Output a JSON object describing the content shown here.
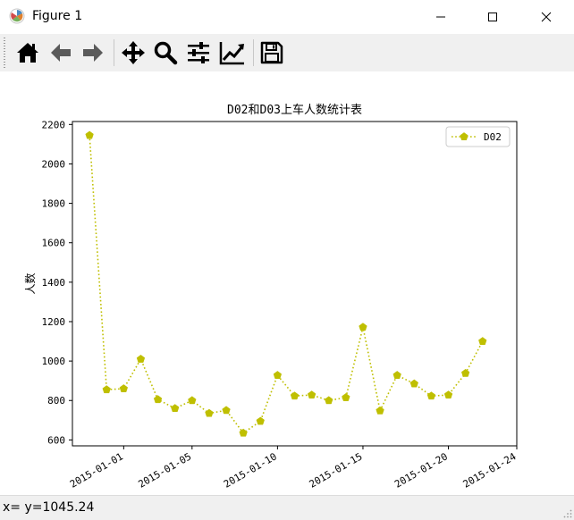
{
  "window": {
    "title": "Figure 1",
    "icon": "matplotlib-icon",
    "controls": [
      "minimize-icon",
      "maximize-icon",
      "close-icon"
    ]
  },
  "toolbar": {
    "buttons": [
      {
        "name": "home",
        "icon": "home-icon"
      },
      {
        "name": "back",
        "icon": "back-arrow-icon"
      },
      {
        "name": "forward",
        "icon": "forward-arrow-icon"
      },
      {
        "name": "pan",
        "icon": "move-icon"
      },
      {
        "name": "zoom",
        "icon": "zoom-icon"
      },
      {
        "name": "subplots",
        "icon": "sliders-icon"
      },
      {
        "name": "customize",
        "icon": "line-chart-icon"
      },
      {
        "name": "save",
        "icon": "save-icon"
      }
    ]
  },
  "status": {
    "text": "x= y=1045.24"
  },
  "chart_data": {
    "type": "line",
    "title": "D02和D03上车人数统计表",
    "xlabel": "",
    "ylabel": "人数",
    "x": [
      "2014-12-30",
      "2014-12-31",
      "2015-01-01",
      "2015-01-02",
      "2015-01-03",
      "2015-01-04",
      "2015-01-05",
      "2015-01-06",
      "2015-01-07",
      "2015-01-08",
      "2015-01-09",
      "2015-01-10",
      "2015-01-11",
      "2015-01-12",
      "2015-01-13",
      "2015-01-14",
      "2015-01-15",
      "2015-01-16",
      "2015-01-17",
      "2015-01-18",
      "2015-01-19",
      "2015-01-20",
      "2015-01-21",
      "2015-01-22"
    ],
    "series": [
      {
        "name": "D02",
        "color": "#bfbf00",
        "linestyle": "dotted",
        "marker": "pentagon",
        "values": [
          2145,
          855,
          860,
          1010,
          805,
          760,
          800,
          735,
          750,
          635,
          695,
          928,
          823,
          828,
          800,
          815,
          1172,
          748,
          928,
          885,
          823,
          828,
          938,
          1100
        ]
      }
    ],
    "x_ticks": [
      "2015-01-01",
      "2015-01-05",
      "2015-01-10",
      "2015-01-15",
      "2015-01-20",
      "2015-01-24"
    ],
    "y_ticks": [
      600,
      800,
      1000,
      1200,
      1400,
      1600,
      1800,
      2000,
      2200
    ],
    "xlim": [
      "2014-12-29",
      "2015-01-24"
    ],
    "ylim": [
      570,
      2215
    ],
    "grid": false,
    "legend": "top-right"
  }
}
